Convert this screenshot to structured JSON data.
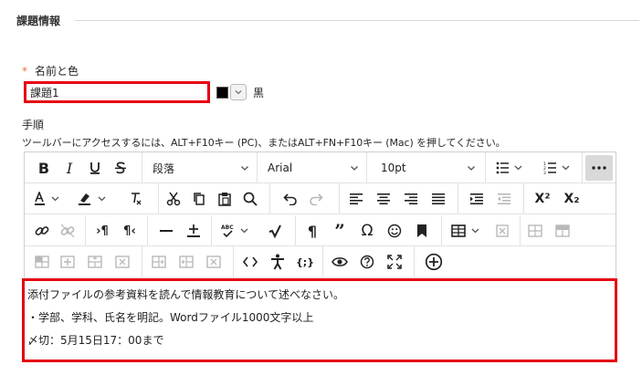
{
  "section": {
    "title": "課題情報"
  },
  "name_field": {
    "required_mark": "*",
    "label": "名前と色",
    "value": "課題1"
  },
  "color": {
    "swatch_hex": "#000000",
    "name": "黒"
  },
  "instructions": {
    "label": "手順",
    "help_text": "ツールバーにアクセスするには、ALT+F10キー (PC)、またはALT+FN+F10キー (Mac) を押してください。"
  },
  "toolbar": {
    "paragraph_format": "段落",
    "font_family": "Arial",
    "font_size": "10pt",
    "special_char": "Ω",
    "more_icon": "more-horizontal-icon"
  },
  "editor": {
    "lines": [
      "添付ファイルの参考資料を読んで情報教育について述べなさい。",
      "・学部、学科、氏名を明記。Wordファイル1000文字以上",
      "〆切：5月15日17：00まで"
    ]
  },
  "highlight_color": "#e60012"
}
